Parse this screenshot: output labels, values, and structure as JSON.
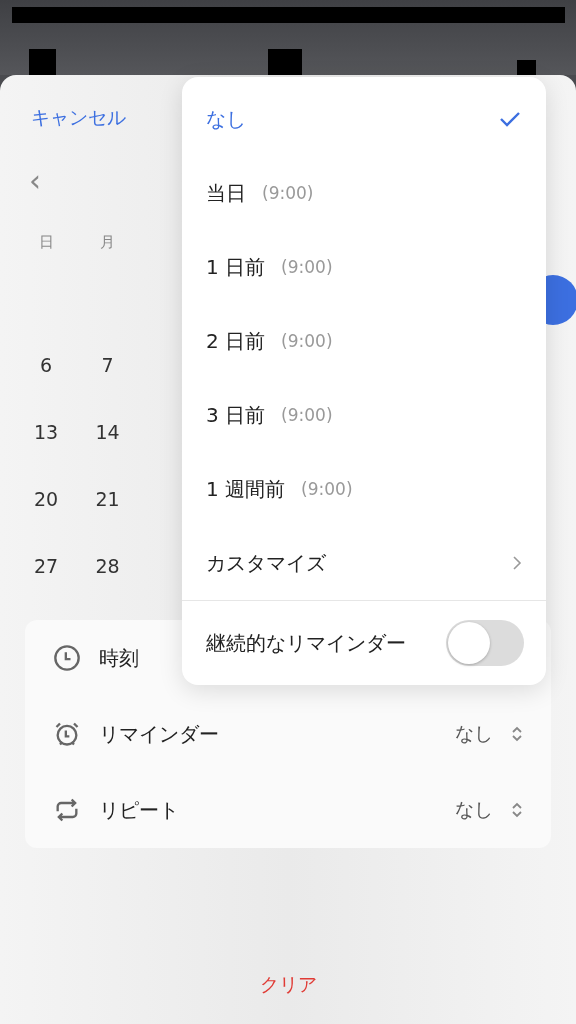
{
  "header": {
    "cancel": "キャンセル",
    "prev": "‹"
  },
  "calendar": {
    "weekdays": [
      "日",
      "月"
    ],
    "weeks": [
      [
        "6",
        "7"
      ],
      [
        "13",
        "14"
      ],
      [
        "20",
        "21"
      ],
      [
        "27",
        "28"
      ]
    ]
  },
  "settings": [
    {
      "kind": "time",
      "label": "時刻"
    },
    {
      "kind": "reminder",
      "label": "リマインダー",
      "value": "なし"
    },
    {
      "kind": "repeat",
      "label": "リピート",
      "value": "なし"
    }
  ],
  "reminder_menu": {
    "options": [
      {
        "kind": "option",
        "label": "なし",
        "selected": true
      },
      {
        "kind": "option",
        "label": "当日",
        "time": "(9:00)",
        "selected": false
      },
      {
        "kind": "option",
        "label": "1 日前",
        "time": "(9:00)",
        "selected": false
      },
      {
        "kind": "option",
        "label": "2 日前",
        "time": "(9:00)",
        "selected": false
      },
      {
        "kind": "option",
        "label": "3 日前",
        "time": "(9:00)",
        "selected": false
      },
      {
        "kind": "option",
        "label": "1 週間前",
        "time": "(9:00)",
        "selected": false
      },
      {
        "kind": "link",
        "label": "カスタマイズ"
      }
    ],
    "continuous": {
      "label": "継続的なリマインダー",
      "on": false
    }
  },
  "clear": "クリア"
}
